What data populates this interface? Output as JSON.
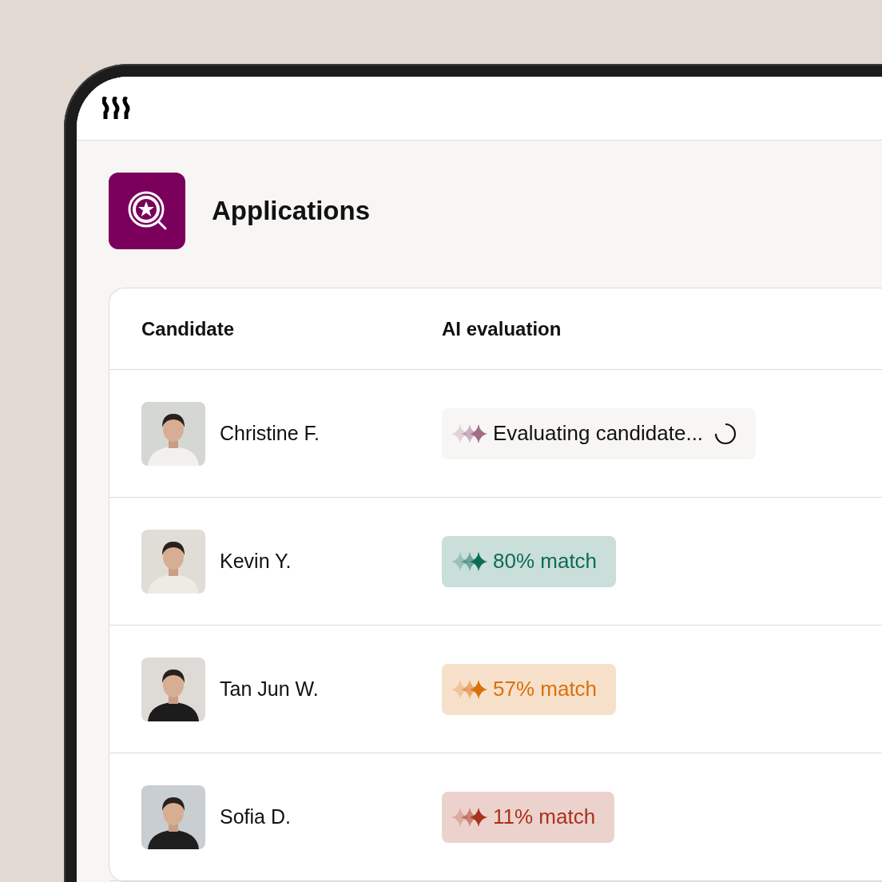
{
  "page": {
    "title": "Applications"
  },
  "table": {
    "columns": [
      "Candidate",
      "AI evaluation"
    ],
    "rows": [
      {
        "name": "Christine F.",
        "evaluation": {
          "kind": "loading",
          "text": "Evaluating candidate...",
          "color": "#a06c88"
        }
      },
      {
        "name": "Kevin Y.",
        "evaluation": {
          "kind": "match",
          "text": "80% match",
          "color": "#0e6b57"
        }
      },
      {
        "name": "Tan Jun W.",
        "evaluation": {
          "kind": "match",
          "text": "57% match",
          "color": "#d9700b"
        }
      },
      {
        "name": "Sofia D.",
        "evaluation": {
          "kind": "match",
          "text": "11% match",
          "color": "#a8321c"
        }
      }
    ]
  }
}
